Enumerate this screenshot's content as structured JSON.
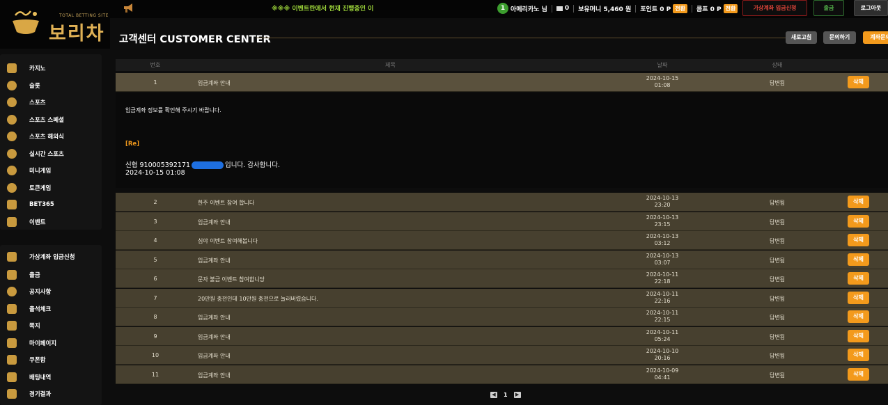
{
  "logo": {
    "site_tag": "TOTAL BETTING SITE",
    "name": "보리차"
  },
  "topbar": {
    "marquee": "※※※ 이벤트란에서 현재 진행중인 이",
    "level": "1",
    "username": "아메리카노 님",
    "messages": "0",
    "money_label": "보유머니 5,460 원",
    "point_label": "포인트 0 P",
    "comp_label": "콤프 0 P",
    "convert_label": "전환",
    "deposit_button": "가상계좌 입금신청",
    "withdraw_button": "출금",
    "logout_button": "로그아웃"
  },
  "sidebar": {
    "games": [
      "카지노",
      "슬롯",
      "스포츠",
      "스포츠 스페셜",
      "스포츠 해외식",
      "실시간 스포츠",
      "미니게임",
      "토큰게임",
      "BET365",
      "이벤트"
    ],
    "account": [
      "가상계좌 입금신청",
      "출금",
      "공지사항",
      "출석체크",
      "쪽지",
      "마이페이지",
      "쿠폰함",
      "배팅내역",
      "경기결과"
    ]
  },
  "header": {
    "title": "고객센터 CUSTOMER CENTER",
    "refresh_button": "새로고침",
    "inquiry_button": "문의하기",
    "account_inquiry_button": "계좌문의"
  },
  "table": {
    "columns": [
      "번호",
      "제목",
      "날짜",
      "상태"
    ],
    "delete_label": "삭제",
    "rows": [
      {
        "no": "1",
        "subject": "입금계좌 안내",
        "date": "2024-10-15",
        "time": "01:08",
        "status": "답변됨"
      },
      {
        "no": "2",
        "subject": "한주 이벤트 참여 합니다",
        "date": "2024-10-13",
        "time": "23:20",
        "status": "답변됨"
      },
      {
        "no": "3",
        "subject": "입금계좌 안내",
        "date": "2024-10-13",
        "time": "23:15",
        "status": "답변됨"
      },
      {
        "no": "4",
        "subject": "심야 이벤트 참여해봅니다",
        "date": "2024-10-13",
        "time": "03:12",
        "status": "답변됨"
      },
      {
        "no": "5",
        "subject": "입금계좌 안내",
        "date": "2024-10-13",
        "time": "03:07",
        "status": "답변됨"
      },
      {
        "no": "6",
        "subject": "문자 불금 이벤트 참여합니당",
        "date": "2024-10-11",
        "time": "22:18",
        "status": "답변됨"
      },
      {
        "no": "7",
        "subject": "20만원 충전인데 10만원 충전으로 눌러버렸습니다.",
        "date": "2024-10-11",
        "time": "22:16",
        "status": "답변됨"
      },
      {
        "no": "8",
        "subject": "입금계좌 안내",
        "date": "2024-10-11",
        "time": "22:15",
        "status": "답변됨"
      },
      {
        "no": "9",
        "subject": "입금계좌 안내",
        "date": "2024-10-11",
        "time": "05:24",
        "status": "답변됨"
      },
      {
        "no": "10",
        "subject": "입금계좌 안내",
        "date": "2024-10-10",
        "time": "20:16",
        "status": "답변됨"
      },
      {
        "no": "11",
        "subject": "입금계좌 안내",
        "date": "2024-10-09",
        "time": "04:41",
        "status": "답변됨"
      }
    ]
  },
  "detail": {
    "question": "입금계좌 정보를 확인해 주시기 바랍니다.",
    "reply_tag": "[Re]",
    "reply_prefix": "신협 910005392171",
    "reply_suffix": "입니다. 감사합니다.",
    "reply_datetime": "2024-10-15 01:08"
  },
  "pagination": {
    "current": "1"
  }
}
